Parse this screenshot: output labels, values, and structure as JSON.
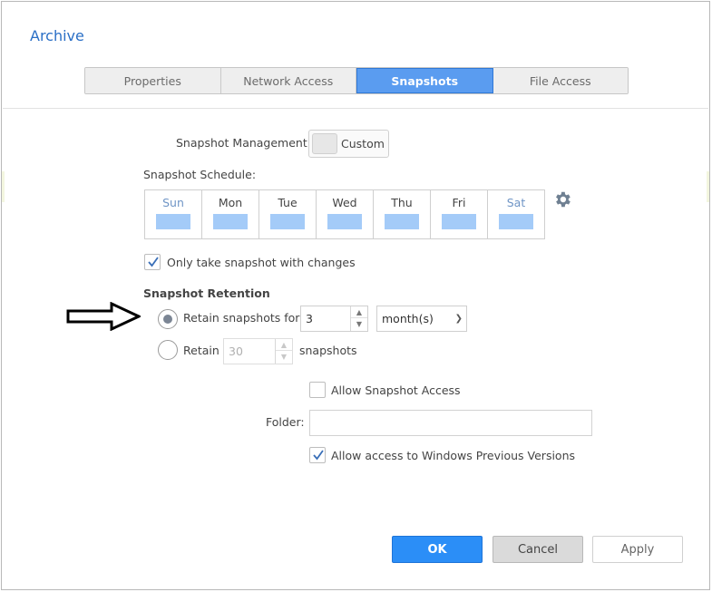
{
  "dialog": {
    "title": "Archive"
  },
  "tabs": [
    {
      "label": "Properties",
      "active": false
    },
    {
      "label": "Network Access",
      "active": false
    },
    {
      "label": "Snapshots",
      "active": true
    },
    {
      "label": "File Access",
      "active": false
    }
  ],
  "snapshot_management": {
    "label": "Snapshot Management:",
    "toggle_label": "Custom"
  },
  "schedule": {
    "label": "Snapshot Schedule:",
    "days": [
      "Sun",
      "Mon",
      "Tue",
      "Wed",
      "Thu",
      "Fri",
      "Sat"
    ],
    "settings_icon": "gear-icon"
  },
  "only_changes": {
    "label": "Only take snapshot with changes",
    "checked": true
  },
  "retention": {
    "heading": "Snapshot Retention",
    "option1": {
      "label": "Retain snapshots for",
      "value": "3",
      "unit": "month(s)",
      "selected": true
    },
    "option2": {
      "label": "Retain",
      "value": "30",
      "suffix": "snapshots",
      "selected": false
    }
  },
  "access": {
    "allow_label": "Allow Snapshot Access",
    "allow_checked": false,
    "folder_label": "Folder:",
    "folder_value": "",
    "windows_label": "Allow access to Windows Previous Versions",
    "windows_checked": true
  },
  "buttons": {
    "ok": "OK",
    "cancel": "Cancel",
    "apply": "Apply"
  },
  "colors": {
    "accent": "#2b8ef7",
    "title": "#2a6fc6",
    "active_tab": "#5a9cf0",
    "day_bar": "#a4cbf8"
  }
}
